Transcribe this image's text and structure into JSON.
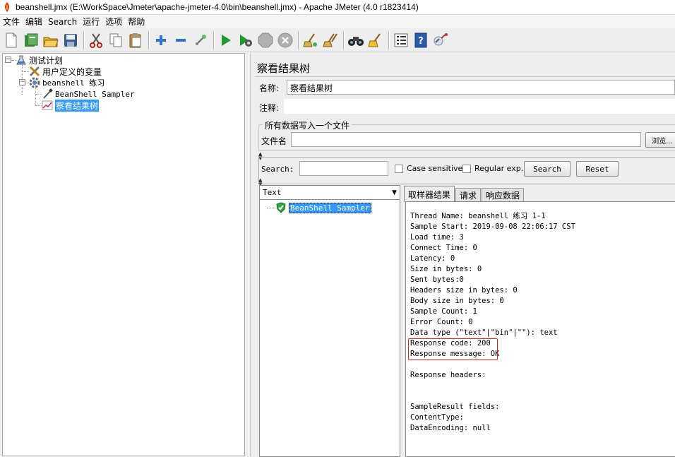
{
  "window": {
    "title": "beanshell.jmx (E:\\WorkSpace\\Jmeter\\apache-jmeter-4.0\\bin\\beanshell.jmx) - Apache JMeter (4.0 r1823414)"
  },
  "menu": [
    "文件",
    "编辑",
    "Search",
    "运行",
    "选项",
    "帮助"
  ],
  "toolbar": {
    "icons": [
      "new-icon",
      "templates-icon",
      "open-icon",
      "save-icon",
      "cut-icon",
      "copy-icon",
      "paste-icon",
      "expand-icon",
      "collapse-icon",
      "toggle-icon",
      "start-icon",
      "start-no-pause-icon",
      "stop-icon",
      "shutdown-icon",
      "clear-icon",
      "clear-all-icon",
      "search-icon",
      "reset-search-icon",
      "function-helper-icon",
      "help-icon",
      "remote-icon"
    ]
  },
  "tree": {
    "plan": "测试计划",
    "udv": "用户定义的变量",
    "thread_group": "beanshell 练习",
    "sampler": "BeanShell Sampler",
    "listener": "察看结果树"
  },
  "panel": {
    "title": "察看结果树",
    "name_label": "名称:",
    "name_value": "察看结果树",
    "comment_label": "注释:",
    "comment_value": "",
    "file_section": "所有数据写入一个文件",
    "filename_label": "文件名",
    "filename_value": "",
    "browse_label": "浏览..."
  },
  "search": {
    "label": "Search:",
    "value": "",
    "case_sensitive": "Case sensitive",
    "regex": "Regular exp.",
    "search_button": "Search",
    "reset_button": "Reset"
  },
  "results": {
    "renderer": "Text",
    "items": [
      "BeanShell Sampler"
    ],
    "tabs": [
      "取样器结果",
      "请求",
      "响应数据"
    ],
    "lines": [
      "Thread Name: beanshell 练习 1-1",
      "Sample Start: 2019-09-08 22:06:17 CST",
      "Load time: 3",
      "Connect Time: 0",
      "Latency: 0",
      "Size in bytes: 0",
      "Sent bytes:0",
      "Headers size in bytes: 0",
      "Body size in bytes: 0",
      "Sample Count: 1",
      "Error Count: 0",
      "Data type (\"text\"|\"bin\"|\"\"): text",
      "Response code: 200",
      "Response message: OK",
      "",
      "Response headers:",
      "",
      "",
      "SampleResult fields:",
      "ContentType:",
      "DataEncoding: null"
    ]
  },
  "colors": {
    "selection": "#3399ff",
    "highlight_box": "#e02020"
  }
}
